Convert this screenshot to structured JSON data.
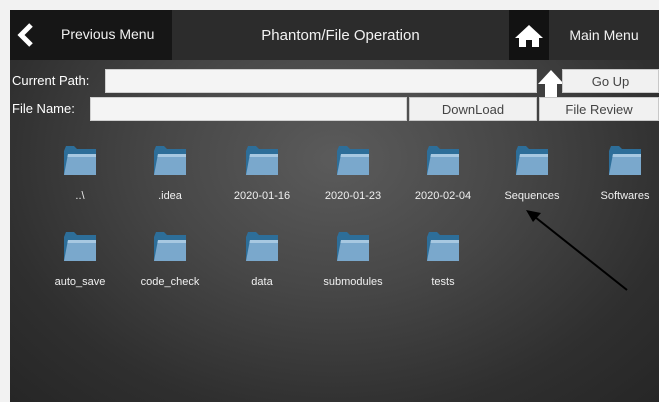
{
  "header": {
    "prev_label": "Previous Menu",
    "title": "Phantom/File Operation",
    "main_label": "Main Menu"
  },
  "path_row": {
    "label": "Current Path:",
    "value": "",
    "go_up_label": "Go Up"
  },
  "file_row": {
    "label": "File Name:",
    "value": "",
    "download_label": "DownLoad",
    "review_label": "File Review"
  },
  "folders": [
    {
      "name": "..\\"
    },
    {
      "name": ".idea"
    },
    {
      "name": "2020-01-16"
    },
    {
      "name": "2020-01-23"
    },
    {
      "name": "2020-02-04"
    },
    {
      "name": "Sequences"
    },
    {
      "name": "Softwares"
    },
    {
      "name": "auto_save"
    },
    {
      "name": "code_check"
    },
    {
      "name": "data"
    },
    {
      "name": "submodules"
    },
    {
      "name": "tests"
    }
  ],
  "icons": {
    "back": "chevron-left-icon",
    "home": "home-icon",
    "go_up": "arrow-up-icon",
    "folder": "folder-icon"
  },
  "colors": {
    "topbar": "#2c2c2c",
    "button_dark": "#161616",
    "folder_front": "#6f9fc4",
    "folder_back": "#2d6e99"
  }
}
